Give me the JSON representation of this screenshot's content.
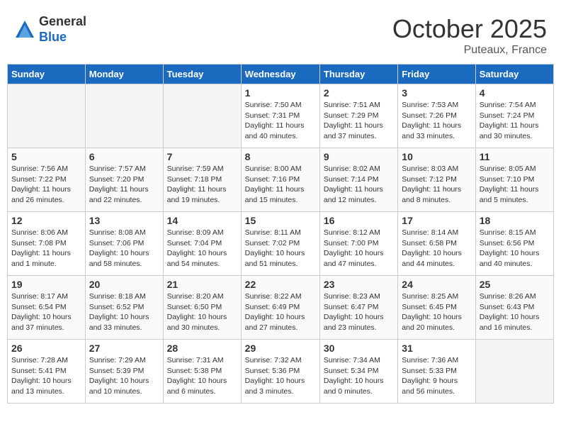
{
  "header": {
    "logo_general": "General",
    "logo_blue": "Blue",
    "month_title": "October 2025",
    "location": "Puteaux, France"
  },
  "weekdays": [
    "Sunday",
    "Monday",
    "Tuesday",
    "Wednesday",
    "Thursday",
    "Friday",
    "Saturday"
  ],
  "weeks": [
    [
      {
        "day": "",
        "empty": true
      },
      {
        "day": "",
        "empty": true
      },
      {
        "day": "",
        "empty": true
      },
      {
        "day": "1",
        "sunrise": "Sunrise: 7:50 AM",
        "sunset": "Sunset: 7:31 PM",
        "daylight": "Daylight: 11 hours and 40 minutes."
      },
      {
        "day": "2",
        "sunrise": "Sunrise: 7:51 AM",
        "sunset": "Sunset: 7:29 PM",
        "daylight": "Daylight: 11 hours and 37 minutes."
      },
      {
        "day": "3",
        "sunrise": "Sunrise: 7:53 AM",
        "sunset": "Sunset: 7:26 PM",
        "daylight": "Daylight: 11 hours and 33 minutes."
      },
      {
        "day": "4",
        "sunrise": "Sunrise: 7:54 AM",
        "sunset": "Sunset: 7:24 PM",
        "daylight": "Daylight: 11 hours and 30 minutes."
      }
    ],
    [
      {
        "day": "5",
        "sunrise": "Sunrise: 7:56 AM",
        "sunset": "Sunset: 7:22 PM",
        "daylight": "Daylight: 11 hours and 26 minutes."
      },
      {
        "day": "6",
        "sunrise": "Sunrise: 7:57 AM",
        "sunset": "Sunset: 7:20 PM",
        "daylight": "Daylight: 11 hours and 22 minutes."
      },
      {
        "day": "7",
        "sunrise": "Sunrise: 7:59 AM",
        "sunset": "Sunset: 7:18 PM",
        "daylight": "Daylight: 11 hours and 19 minutes."
      },
      {
        "day": "8",
        "sunrise": "Sunrise: 8:00 AM",
        "sunset": "Sunset: 7:16 PM",
        "daylight": "Daylight: 11 hours and 15 minutes."
      },
      {
        "day": "9",
        "sunrise": "Sunrise: 8:02 AM",
        "sunset": "Sunset: 7:14 PM",
        "daylight": "Daylight: 11 hours and 12 minutes."
      },
      {
        "day": "10",
        "sunrise": "Sunrise: 8:03 AM",
        "sunset": "Sunset: 7:12 PM",
        "daylight": "Daylight: 11 hours and 8 minutes."
      },
      {
        "day": "11",
        "sunrise": "Sunrise: 8:05 AM",
        "sunset": "Sunset: 7:10 PM",
        "daylight": "Daylight: 11 hours and 5 minutes."
      }
    ],
    [
      {
        "day": "12",
        "sunrise": "Sunrise: 8:06 AM",
        "sunset": "Sunset: 7:08 PM",
        "daylight": "Daylight: 11 hours and 1 minute."
      },
      {
        "day": "13",
        "sunrise": "Sunrise: 8:08 AM",
        "sunset": "Sunset: 7:06 PM",
        "daylight": "Daylight: 10 hours and 58 minutes."
      },
      {
        "day": "14",
        "sunrise": "Sunrise: 8:09 AM",
        "sunset": "Sunset: 7:04 PM",
        "daylight": "Daylight: 10 hours and 54 minutes."
      },
      {
        "day": "15",
        "sunrise": "Sunrise: 8:11 AM",
        "sunset": "Sunset: 7:02 PM",
        "daylight": "Daylight: 10 hours and 51 minutes."
      },
      {
        "day": "16",
        "sunrise": "Sunrise: 8:12 AM",
        "sunset": "Sunset: 7:00 PM",
        "daylight": "Daylight: 10 hours and 47 minutes."
      },
      {
        "day": "17",
        "sunrise": "Sunrise: 8:14 AM",
        "sunset": "Sunset: 6:58 PM",
        "daylight": "Daylight: 10 hours and 44 minutes."
      },
      {
        "day": "18",
        "sunrise": "Sunrise: 8:15 AM",
        "sunset": "Sunset: 6:56 PM",
        "daylight": "Daylight: 10 hours and 40 minutes."
      }
    ],
    [
      {
        "day": "19",
        "sunrise": "Sunrise: 8:17 AM",
        "sunset": "Sunset: 6:54 PM",
        "daylight": "Daylight: 10 hours and 37 minutes."
      },
      {
        "day": "20",
        "sunrise": "Sunrise: 8:18 AM",
        "sunset": "Sunset: 6:52 PM",
        "daylight": "Daylight: 10 hours and 33 minutes."
      },
      {
        "day": "21",
        "sunrise": "Sunrise: 8:20 AM",
        "sunset": "Sunset: 6:50 PM",
        "daylight": "Daylight: 10 hours and 30 minutes."
      },
      {
        "day": "22",
        "sunrise": "Sunrise: 8:22 AM",
        "sunset": "Sunset: 6:49 PM",
        "daylight": "Daylight: 10 hours and 27 minutes."
      },
      {
        "day": "23",
        "sunrise": "Sunrise: 8:23 AM",
        "sunset": "Sunset: 6:47 PM",
        "daylight": "Daylight: 10 hours and 23 minutes."
      },
      {
        "day": "24",
        "sunrise": "Sunrise: 8:25 AM",
        "sunset": "Sunset: 6:45 PM",
        "daylight": "Daylight: 10 hours and 20 minutes."
      },
      {
        "day": "25",
        "sunrise": "Sunrise: 8:26 AM",
        "sunset": "Sunset: 6:43 PM",
        "daylight": "Daylight: 10 hours and 16 minutes."
      }
    ],
    [
      {
        "day": "26",
        "sunrise": "Sunrise: 7:28 AM",
        "sunset": "Sunset: 5:41 PM",
        "daylight": "Daylight: 10 hours and 13 minutes."
      },
      {
        "day": "27",
        "sunrise": "Sunrise: 7:29 AM",
        "sunset": "Sunset: 5:39 PM",
        "daylight": "Daylight: 10 hours and 10 minutes."
      },
      {
        "day": "28",
        "sunrise": "Sunrise: 7:31 AM",
        "sunset": "Sunset: 5:38 PM",
        "daylight": "Daylight: 10 hours and 6 minutes."
      },
      {
        "day": "29",
        "sunrise": "Sunrise: 7:32 AM",
        "sunset": "Sunset: 5:36 PM",
        "daylight": "Daylight: 10 hours and 3 minutes."
      },
      {
        "day": "30",
        "sunrise": "Sunrise: 7:34 AM",
        "sunset": "Sunset: 5:34 PM",
        "daylight": "Daylight: 10 hours and 0 minutes."
      },
      {
        "day": "31",
        "sunrise": "Sunrise: 7:36 AM",
        "sunset": "Sunset: 5:33 PM",
        "daylight": "Daylight: 9 hours and 56 minutes."
      },
      {
        "day": "",
        "empty": true
      }
    ]
  ]
}
